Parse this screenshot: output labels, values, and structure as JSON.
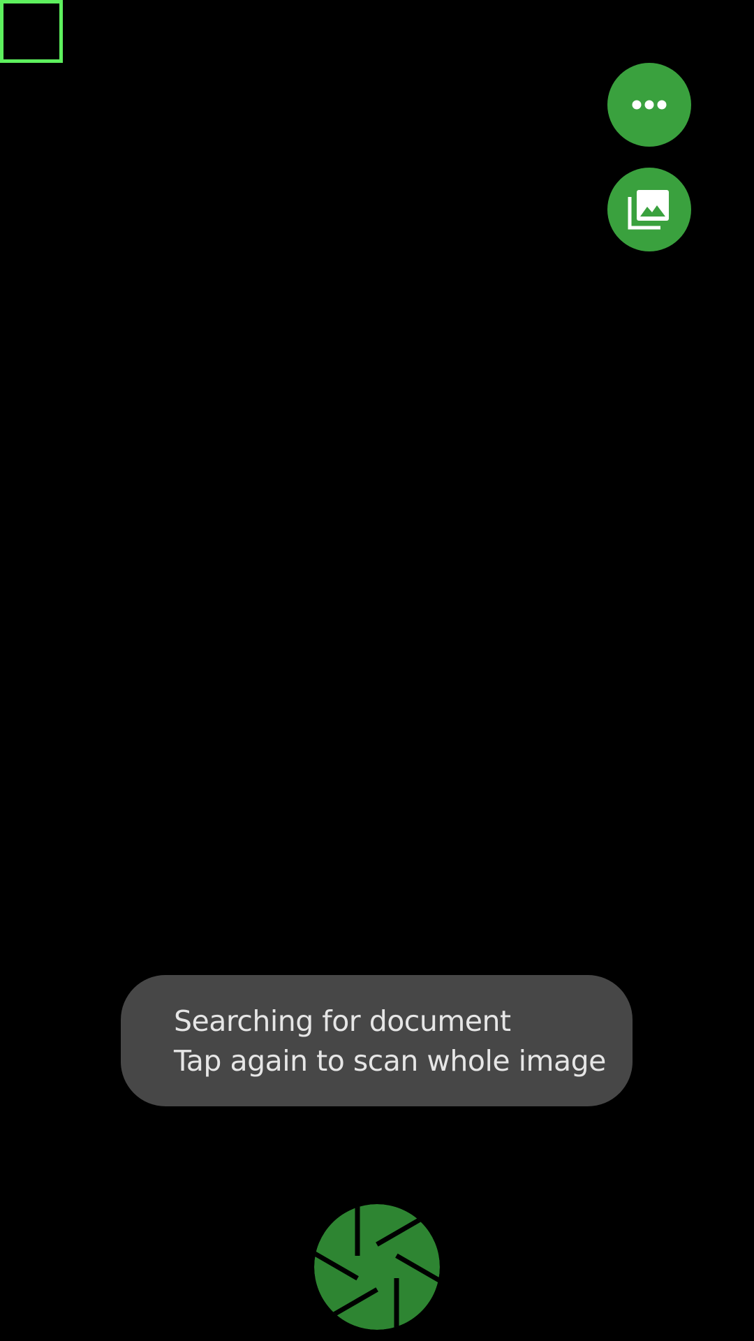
{
  "colors": {
    "background": "#000000",
    "detect_frame": "#5ef05e",
    "fab": "#3aa13e",
    "toast_bg": "#474747",
    "toast_text": "#e6e6e6",
    "shutter": "#2e8532"
  },
  "actions": {
    "more": {
      "icon": "more-horiz-icon"
    },
    "gallery": {
      "icon": "photo-library-icon"
    }
  },
  "toast": {
    "line1": "Searching for document",
    "line2": "Tap again to scan whole image"
  },
  "shutter": {
    "icon": "camera-aperture-icon"
  }
}
